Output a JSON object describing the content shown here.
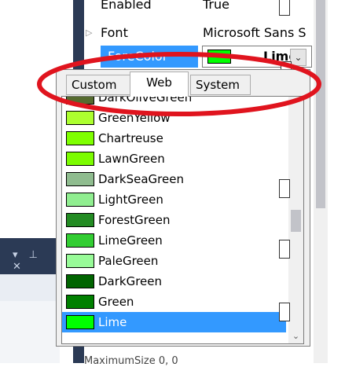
{
  "properties": {
    "enabled": {
      "name": "Enabled",
      "value": "True"
    },
    "font": {
      "name": "Font",
      "value": "Microsoft Sans S"
    },
    "forecolor": {
      "name": "ForeColor",
      "value": "Lime",
      "swatch": "#00ff00"
    }
  },
  "tabs": [
    {
      "label": "Custom",
      "active": false
    },
    {
      "label": "Web",
      "active": true
    },
    {
      "label": "System",
      "active": false
    }
  ],
  "colors": [
    {
      "name": "DarkOliveGreen",
      "hex": "#556b2f"
    },
    {
      "name": "GreenYellow",
      "hex": "#adff2f"
    },
    {
      "name": "Chartreuse",
      "hex": "#7fff00"
    },
    {
      "name": "LawnGreen",
      "hex": "#7cfc00"
    },
    {
      "name": "DarkSeaGreen",
      "hex": "#8fbc8f"
    },
    {
      "name": "LightGreen",
      "hex": "#90ee90"
    },
    {
      "name": "ForestGreen",
      "hex": "#228b22"
    },
    {
      "name": "LimeGreen",
      "hex": "#32cd32"
    },
    {
      "name": "PaleGreen",
      "hex": "#98fb98"
    },
    {
      "name": "DarkGreen",
      "hex": "#006400"
    },
    {
      "name": "Green",
      "hex": "#008000"
    },
    {
      "name": "Lime",
      "hex": "#00ff00",
      "selected": true
    }
  ],
  "bottom_partial": "MaximumSize  0, 0",
  "annotation_color": "#e0141e"
}
